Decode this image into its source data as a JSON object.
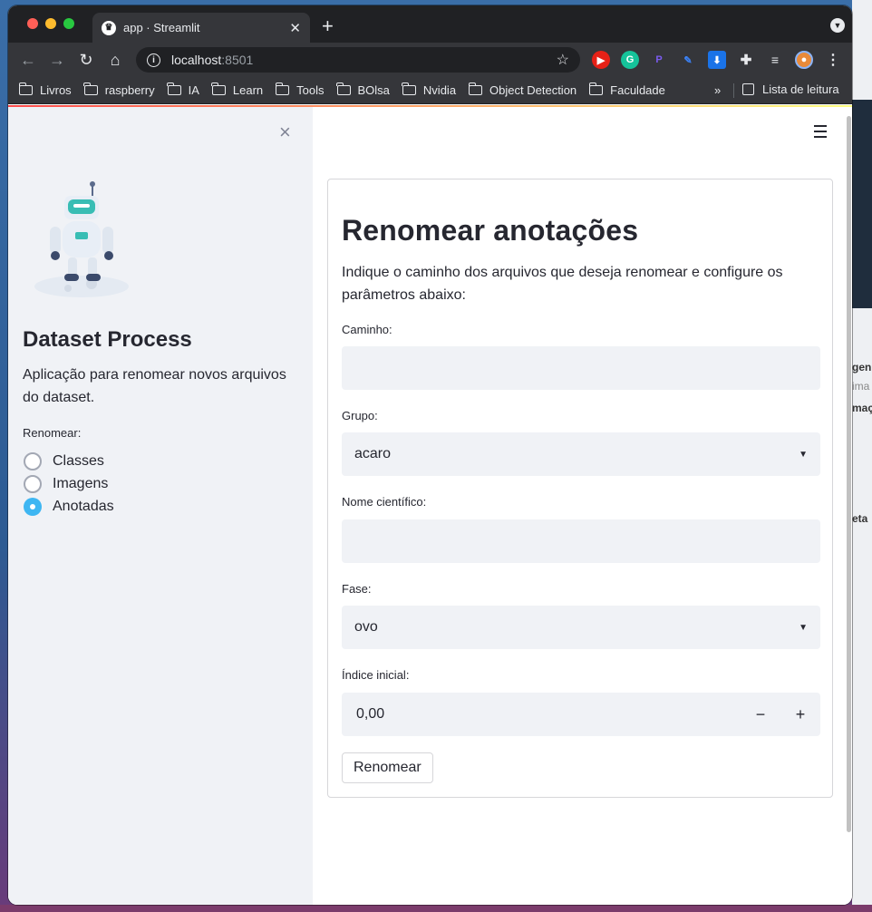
{
  "browser": {
    "tab_title": "app · Streamlit",
    "favicon": "streamlit-crown",
    "new_tab": "+",
    "url_host": "localhost",
    "url_port": ":8501",
    "bookmarks": [
      "Livros",
      "raspberry",
      "IA",
      "Learn",
      "Tools",
      "BOlsa",
      "Nvidia",
      "Object Detection",
      "Faculdade"
    ],
    "bookmarks_more": "»",
    "reading_list": "Lista de leitura"
  },
  "sidebar": {
    "close": "×",
    "title": "Dataset Process",
    "description": "Aplicação para renomear novos arquivos do dataset.",
    "radio_label": "Renomear:",
    "options": [
      "Classes",
      "Imagens",
      "Anotadas"
    ],
    "selected": "Anotadas"
  },
  "main": {
    "title": "Renomear anotações",
    "description": "Indique o caminho dos arquivos que deseja renomear e configure os parâmetros abaixo:",
    "fields": {
      "caminho": {
        "label": "Caminho:",
        "value": ""
      },
      "grupo": {
        "label": "Grupo:",
        "value": "acaro"
      },
      "nome_cientifico": {
        "label": "Nome científico:",
        "value": ""
      },
      "fase": {
        "label": "Fase:",
        "value": "ovo"
      },
      "indice_inicial": {
        "label": "Índice inicial:",
        "value": "0,00",
        "minus": "−",
        "plus": "+"
      }
    },
    "submit_label": "Renomear"
  },
  "colors": {
    "accent": "#3eb6f2",
    "sidebar_bg": "#f0f2f6",
    "input_bg": "#f0f2f6",
    "text": "#262730"
  }
}
